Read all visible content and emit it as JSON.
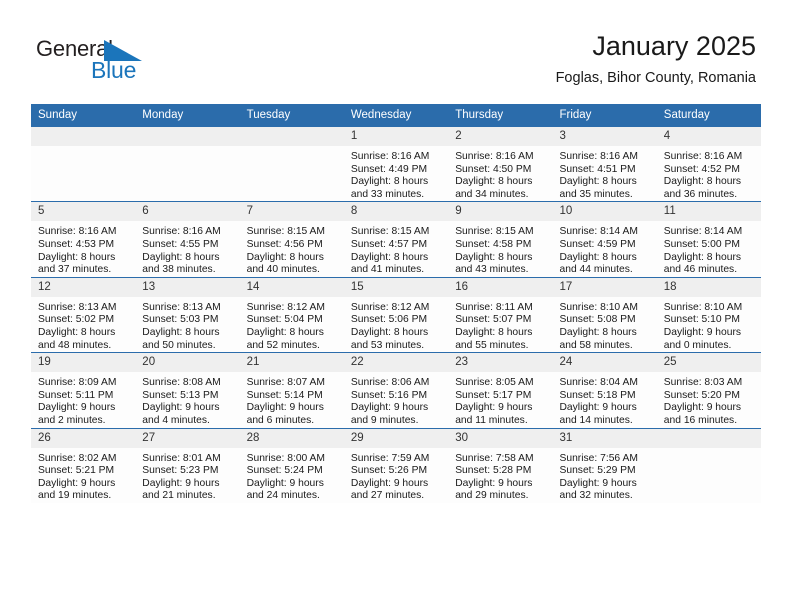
{
  "brand": {
    "name_top": "General",
    "name_bottom": "Blue",
    "triangle_color": "#1b75bb",
    "text_color": "#231f20"
  },
  "header": {
    "title": "January 2025",
    "subtitle": "Foglas, Bihor County, Romania"
  },
  "theme": {
    "header_bg": "#2b6cab",
    "header_text": "#ffffff",
    "daynum_bg": "#efefef",
    "cell_bg": "#fdfdfd",
    "grid_line": "#2b6cab"
  },
  "weekdays": [
    "Sunday",
    "Monday",
    "Tuesday",
    "Wednesday",
    "Thursday",
    "Friday",
    "Saturday"
  ],
  "labels": {
    "sunrise_prefix": "Sunrise:",
    "sunset_prefix": "Sunset:",
    "daylight_prefix": "Daylight:"
  },
  "weeks": [
    [
      {
        "day": "",
        "empty": true,
        "l1": "",
        "l2": "",
        "l3": "",
        "l4": ""
      },
      {
        "day": "",
        "empty": true,
        "l1": "",
        "l2": "",
        "l3": "",
        "l4": ""
      },
      {
        "day": "",
        "empty": true,
        "l1": "",
        "l2": "",
        "l3": "",
        "l4": ""
      },
      {
        "day": "1",
        "empty": false,
        "l1": "Sunrise: 8:16 AM",
        "l2": "Sunset: 4:49 PM",
        "l3": "Daylight: 8 hours",
        "l4": "and 33 minutes."
      },
      {
        "day": "2",
        "empty": false,
        "l1": "Sunrise: 8:16 AM",
        "l2": "Sunset: 4:50 PM",
        "l3": "Daylight: 8 hours",
        "l4": "and 34 minutes."
      },
      {
        "day": "3",
        "empty": false,
        "l1": "Sunrise: 8:16 AM",
        "l2": "Sunset: 4:51 PM",
        "l3": "Daylight: 8 hours",
        "l4": "and 35 minutes."
      },
      {
        "day": "4",
        "empty": false,
        "l1": "Sunrise: 8:16 AM",
        "l2": "Sunset: 4:52 PM",
        "l3": "Daylight: 8 hours",
        "l4": "and 36 minutes."
      }
    ],
    [
      {
        "day": "5",
        "empty": false,
        "l1": "Sunrise: 8:16 AM",
        "l2": "Sunset: 4:53 PM",
        "l3": "Daylight: 8 hours",
        "l4": "and 37 minutes."
      },
      {
        "day": "6",
        "empty": false,
        "l1": "Sunrise: 8:16 AM",
        "l2": "Sunset: 4:55 PM",
        "l3": "Daylight: 8 hours",
        "l4": "and 38 minutes."
      },
      {
        "day": "7",
        "empty": false,
        "l1": "Sunrise: 8:15 AM",
        "l2": "Sunset: 4:56 PM",
        "l3": "Daylight: 8 hours",
        "l4": "and 40 minutes."
      },
      {
        "day": "8",
        "empty": false,
        "l1": "Sunrise: 8:15 AM",
        "l2": "Sunset: 4:57 PM",
        "l3": "Daylight: 8 hours",
        "l4": "and 41 minutes."
      },
      {
        "day": "9",
        "empty": false,
        "l1": "Sunrise: 8:15 AM",
        "l2": "Sunset: 4:58 PM",
        "l3": "Daylight: 8 hours",
        "l4": "and 43 minutes."
      },
      {
        "day": "10",
        "empty": false,
        "l1": "Sunrise: 8:14 AM",
        "l2": "Sunset: 4:59 PM",
        "l3": "Daylight: 8 hours",
        "l4": "and 44 minutes."
      },
      {
        "day": "11",
        "empty": false,
        "l1": "Sunrise: 8:14 AM",
        "l2": "Sunset: 5:00 PM",
        "l3": "Daylight: 8 hours",
        "l4": "and 46 minutes."
      }
    ],
    [
      {
        "day": "12",
        "empty": false,
        "l1": "Sunrise: 8:13 AM",
        "l2": "Sunset: 5:02 PM",
        "l3": "Daylight: 8 hours",
        "l4": "and 48 minutes."
      },
      {
        "day": "13",
        "empty": false,
        "l1": "Sunrise: 8:13 AM",
        "l2": "Sunset: 5:03 PM",
        "l3": "Daylight: 8 hours",
        "l4": "and 50 minutes."
      },
      {
        "day": "14",
        "empty": false,
        "l1": "Sunrise: 8:12 AM",
        "l2": "Sunset: 5:04 PM",
        "l3": "Daylight: 8 hours",
        "l4": "and 52 minutes."
      },
      {
        "day": "15",
        "empty": false,
        "l1": "Sunrise: 8:12 AM",
        "l2": "Sunset: 5:06 PM",
        "l3": "Daylight: 8 hours",
        "l4": "and 53 minutes."
      },
      {
        "day": "16",
        "empty": false,
        "l1": "Sunrise: 8:11 AM",
        "l2": "Sunset: 5:07 PM",
        "l3": "Daylight: 8 hours",
        "l4": "and 55 minutes."
      },
      {
        "day": "17",
        "empty": false,
        "l1": "Sunrise: 8:10 AM",
        "l2": "Sunset: 5:08 PM",
        "l3": "Daylight: 8 hours",
        "l4": "and 58 minutes."
      },
      {
        "day": "18",
        "empty": false,
        "l1": "Sunrise: 8:10 AM",
        "l2": "Sunset: 5:10 PM",
        "l3": "Daylight: 9 hours",
        "l4": "and 0 minutes."
      }
    ],
    [
      {
        "day": "19",
        "empty": false,
        "l1": "Sunrise: 8:09 AM",
        "l2": "Sunset: 5:11 PM",
        "l3": "Daylight: 9 hours",
        "l4": "and 2 minutes."
      },
      {
        "day": "20",
        "empty": false,
        "l1": "Sunrise: 8:08 AM",
        "l2": "Sunset: 5:13 PM",
        "l3": "Daylight: 9 hours",
        "l4": "and 4 minutes."
      },
      {
        "day": "21",
        "empty": false,
        "l1": "Sunrise: 8:07 AM",
        "l2": "Sunset: 5:14 PM",
        "l3": "Daylight: 9 hours",
        "l4": "and 6 minutes."
      },
      {
        "day": "22",
        "empty": false,
        "l1": "Sunrise: 8:06 AM",
        "l2": "Sunset: 5:16 PM",
        "l3": "Daylight: 9 hours",
        "l4": "and 9 minutes."
      },
      {
        "day": "23",
        "empty": false,
        "l1": "Sunrise: 8:05 AM",
        "l2": "Sunset: 5:17 PM",
        "l3": "Daylight: 9 hours",
        "l4": "and 11 minutes."
      },
      {
        "day": "24",
        "empty": false,
        "l1": "Sunrise: 8:04 AM",
        "l2": "Sunset: 5:18 PM",
        "l3": "Daylight: 9 hours",
        "l4": "and 14 minutes."
      },
      {
        "day": "25",
        "empty": false,
        "l1": "Sunrise: 8:03 AM",
        "l2": "Sunset: 5:20 PM",
        "l3": "Daylight: 9 hours",
        "l4": "and 16 minutes."
      }
    ],
    [
      {
        "day": "26",
        "empty": false,
        "l1": "Sunrise: 8:02 AM",
        "l2": "Sunset: 5:21 PM",
        "l3": "Daylight: 9 hours",
        "l4": "and 19 minutes."
      },
      {
        "day": "27",
        "empty": false,
        "l1": "Sunrise: 8:01 AM",
        "l2": "Sunset: 5:23 PM",
        "l3": "Daylight: 9 hours",
        "l4": "and 21 minutes."
      },
      {
        "day": "28",
        "empty": false,
        "l1": "Sunrise: 8:00 AM",
        "l2": "Sunset: 5:24 PM",
        "l3": "Daylight: 9 hours",
        "l4": "and 24 minutes."
      },
      {
        "day": "29",
        "empty": false,
        "l1": "Sunrise: 7:59 AM",
        "l2": "Sunset: 5:26 PM",
        "l3": "Daylight: 9 hours",
        "l4": "and 27 minutes."
      },
      {
        "day": "30",
        "empty": false,
        "l1": "Sunrise: 7:58 AM",
        "l2": "Sunset: 5:28 PM",
        "l3": "Daylight: 9 hours",
        "l4": "and 29 minutes."
      },
      {
        "day": "31",
        "empty": false,
        "l1": "Sunrise: 7:56 AM",
        "l2": "Sunset: 5:29 PM",
        "l3": "Daylight: 9 hours",
        "l4": "and 32 minutes."
      },
      {
        "day": "",
        "empty": true,
        "l1": "",
        "l2": "",
        "l3": "",
        "l4": ""
      }
    ]
  ]
}
